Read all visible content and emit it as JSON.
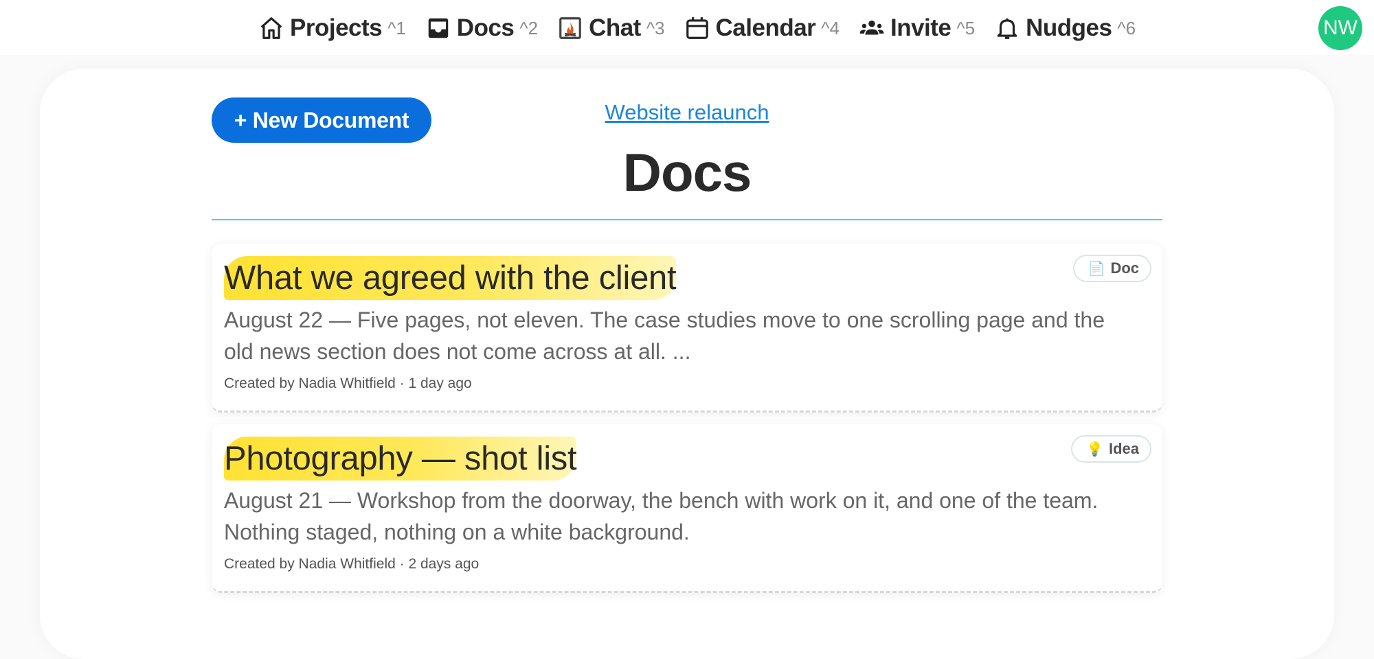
{
  "nav": {
    "items": [
      {
        "label": "Projects",
        "shortcut": "^1",
        "icon": "home-icon"
      },
      {
        "label": "Docs",
        "shortcut": "^2",
        "icon": "inbox-icon"
      },
      {
        "label": "Chat",
        "shortcut": "^3",
        "icon": "campfire-icon"
      },
      {
        "label": "Calendar",
        "shortcut": "^4",
        "icon": "calendar-icon"
      },
      {
        "label": "Invite",
        "shortcut": "^5",
        "icon": "people-icon"
      },
      {
        "label": "Nudges",
        "shortcut": "^6",
        "icon": "bell-icon"
      }
    ],
    "avatar_initials": "NW",
    "avatar_color": "#1fc97f"
  },
  "main": {
    "new_doc_label": "+ New Document",
    "project_link": "Website relaunch",
    "title": "Docs"
  },
  "docs": [
    {
      "title": "What we agreed with the client",
      "excerpt": "August 22 — Five pages, not eleven. The case studies move to one scrolling page and the old news section does not come across at all. ...",
      "meta": "Created by Nadia Whitfield · 1 day ago",
      "badge": "Doc",
      "badge_icon": "document-icon"
    },
    {
      "title": "Photography — shot list",
      "excerpt": "August 21 — Workshop from the doorway, the bench with work on it, and one of the team. Nothing staged, nothing on a white background.",
      "meta": "Created by Nadia Whitfield · 2 days ago",
      "badge": "Idea",
      "badge_icon": "lightbulb-icon"
    }
  ],
  "colors": {
    "accent": "#0a6edc",
    "link": "#1b86d9",
    "highlight": "#ffe233",
    "divider": "#54c9e8"
  }
}
